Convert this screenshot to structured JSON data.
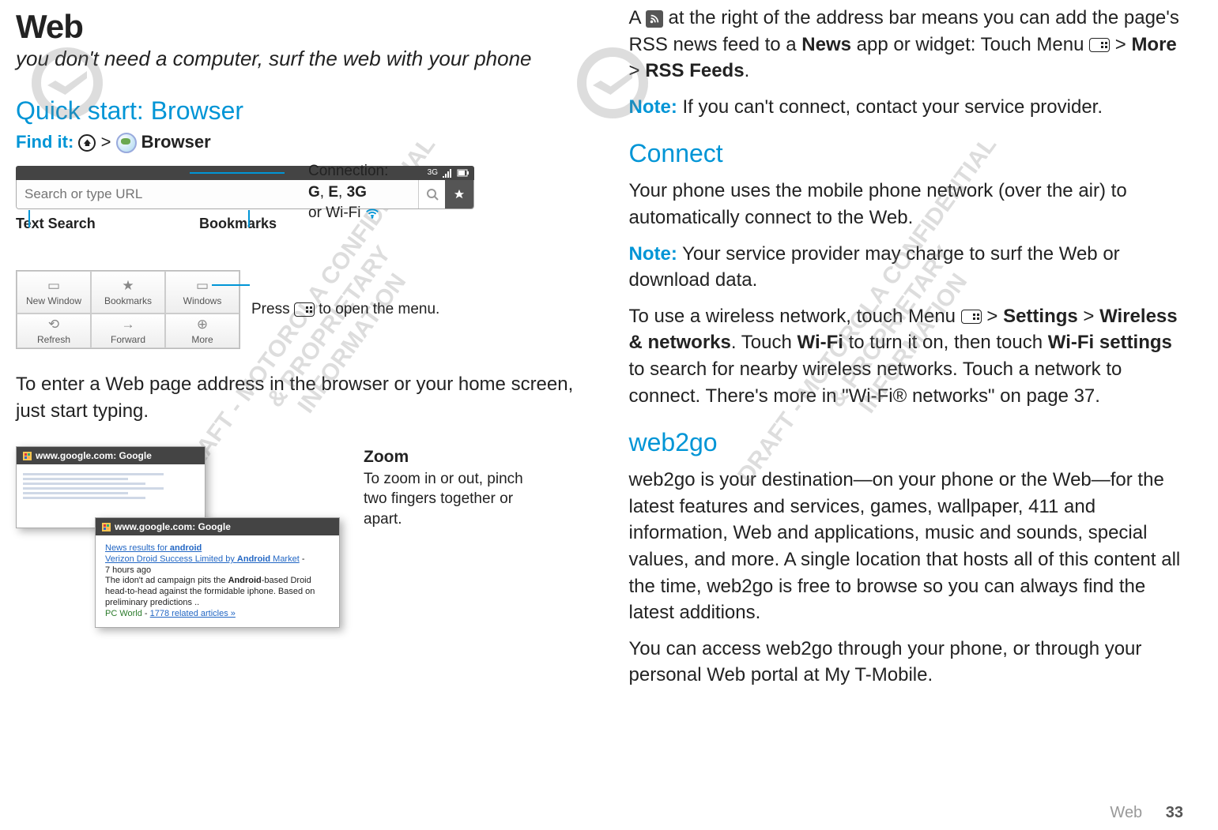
{
  "left": {
    "heading": "Web",
    "subtitle": "you don't need a computer, surf the web with your phone",
    "quick_start": "Quick start: Browser",
    "findit_label": "Find it:",
    "findit_sep": ">",
    "findit_app": "Browser",
    "url_placeholder": "Search or type URL",
    "status_3g": "3G",
    "conn_label": "Connection:",
    "conn_g": "G",
    "conn_e": "E",
    "conn_3g": "3G",
    "conn_or": "or Wi-Fi",
    "text_search_label": "Text Search",
    "bookmarks_label": "Bookmarks",
    "menu_items": {
      "new_window": "New Window",
      "bookmarks": "Bookmarks",
      "windows": "Windows",
      "refresh": "Refresh",
      "forward": "Forward",
      "more": "More"
    },
    "menu_open_text_1": "Press ",
    "menu_open_text_2": " to open the menu.",
    "enter_text": "To enter a Web page address in the browser or your home screen, just start typing.",
    "zoom_title": "Zoom",
    "zoom_text": "To zoom in or out, pinch two fingers together or apart.",
    "win1_title": "www.google.com: Google",
    "win2_title": "www.google.com: Google",
    "win2_line1_a": "News results for ",
    "win2_line1_b": "android",
    "win2_line2_a": "Verizon Droid Success Limited by ",
    "win2_line2_b": "Android",
    "win2_line2_c": " Market",
    "win2_line3": "7 hours ago",
    "win2_line4_a": "The idon't ad campaign pits the ",
    "win2_line4_b": "Android",
    "win2_line4_c": "-based Droid head-to-head against the formidable iphone. Based on preliminary predictions ..",
    "win2_line5_a": "PC World",
    "win2_line5_b": " - ",
    "win2_line5_c": "1778 related articles »"
  },
  "right": {
    "p1_a": "A ",
    "p1_b": " at the right of the address bar means you can add the page's RSS news feed to a ",
    "p1_news": "News",
    "p1_c": " app or widget: Touch Menu ",
    "p1_sep": " > ",
    "p1_more": "More",
    "p1_rss": "RSS Feeds",
    "p1_d": ".",
    "note": "Note:",
    "p2": " If you can't connect, contact your service provider.",
    "connect_title": "Connect",
    "p3": "Your phone uses the mobile phone network (over the air) to automatically connect to the Web.",
    "p4": " Your service provider may charge to surf the Web or download data.",
    "p5_a": "To use a wireless network, touch Menu ",
    "p5_settings": "Settings",
    "p5_wn": "Wireless & networks",
    "p5_b": ". Touch ",
    "p5_wifi": "Wi-Fi",
    "p5_c": " to turn it on, then touch ",
    "p5_wifis": "Wi-Fi settings",
    "p5_d": " to search for nearby wireless networks. Touch a network to connect. There's more in \"Wi-Fi® networks\" on page 37.",
    "web2go_title": "web2go",
    "p6": "web2go is your destination—on your phone or the Web—for the latest features and services, games, wallpaper, 411 and information, Web and applications, music and sounds, special values, and more. A single location that hosts all of this content all the time, web2go is free to browse so you can always find the latest additions.",
    "p7": "You can access web2go through your phone, or through your personal Web portal at My T-Mobile."
  },
  "footer": {
    "section": "Web",
    "page": "33"
  },
  "watermark": "DRAFT - MOTOROLA CONFIDENTIAL\n& PROPRIETARY\nINFORMATION"
}
